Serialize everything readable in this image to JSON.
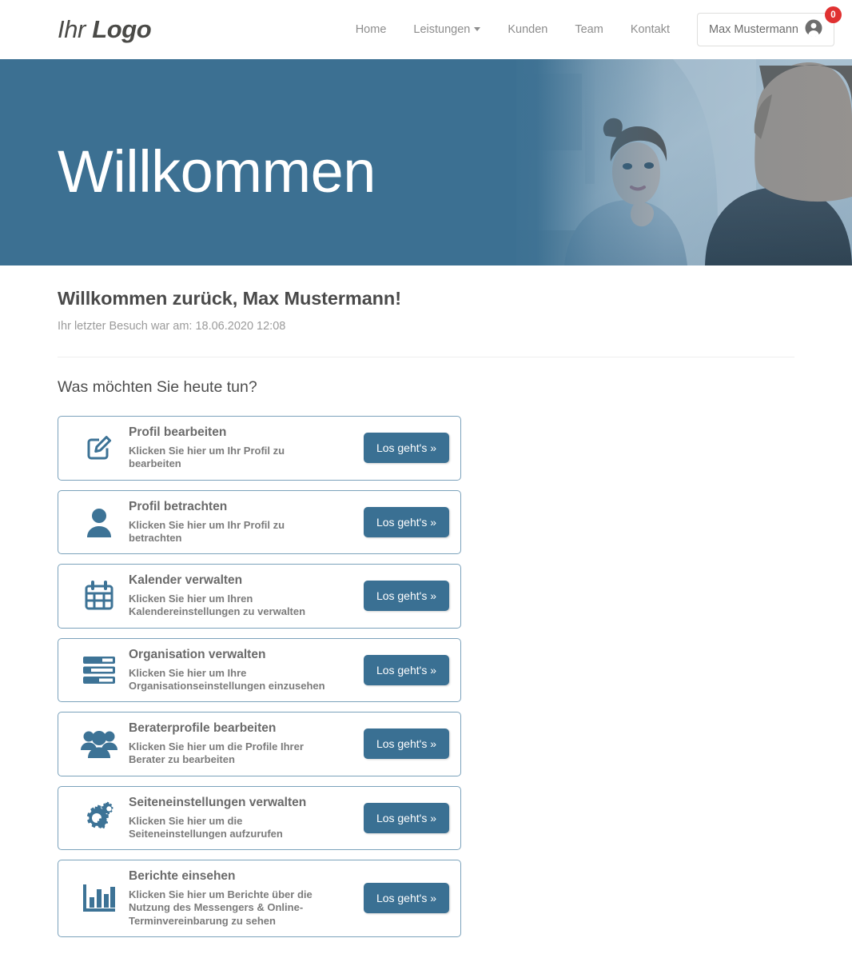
{
  "navbar": {
    "logo_light": "Ihr",
    "logo_bold": "Logo",
    "links": [
      {
        "label": "Home",
        "icon": "",
        "has_caret": false
      },
      {
        "label": "Leistungen",
        "icon": "chevron-down-icon",
        "has_caret": true
      },
      {
        "label": "Kunden",
        "icon": "",
        "has_caret": false
      },
      {
        "label": "Team",
        "icon": "",
        "has_caret": false
      },
      {
        "label": "Kontakt",
        "icon": "",
        "has_caret": false
      }
    ],
    "user": {
      "name": "Max Mustermann",
      "avatar_icon": "user-avatar-icon",
      "badge_count": "0",
      "badge_color": "#e03131"
    }
  },
  "hero": {
    "title": "Willkommen",
    "overlay_color": "#3c7092"
  },
  "main": {
    "welcome_title": "Willkommen zurück, Max Mustermann!",
    "last_visit": "Ihr letzter Besuch war am: 18.06.2020 12:08",
    "section_title": "Was möchten Sie heute tun?",
    "accent_color": "#3a7093",
    "card_border_color": "#7ba2bb",
    "cards": [
      {
        "icon": "edit-profile-icon",
        "title": "Profil bearbeiten",
        "description": "Klicken Sie hier um Ihr Profil zu bearbeiten",
        "button": "Los geht's »"
      },
      {
        "icon": "user-icon",
        "title": "Profil betrachten",
        "description": "Klicken Sie hier um Ihr Profil zu betrachten",
        "button": "Los geht's »"
      },
      {
        "icon": "calendar-icon",
        "title": "Kalender verwalten",
        "description": "Klicken Sie hier um Ihren Kalendereinstellungen zu verwalten",
        "button": "Los geht's »"
      },
      {
        "icon": "server-icon",
        "title": "Organisation verwalten",
        "description": "Klicken Sie hier um Ihre Organisationseinstellungen einzusehen",
        "button": "Los geht's »"
      },
      {
        "icon": "group-users-icon",
        "title": "Beraterprofile bearbeiten",
        "description": "Klicken Sie hier um die Profile Ihrer Berater zu bearbeiten",
        "button": "Los geht's »"
      },
      {
        "icon": "cogs-icon",
        "title": "Seiteneinstellungen verwalten",
        "description": "Klicken Sie hier um die Seiteneinstellungen aufzurufen",
        "button": "Los geht's »"
      },
      {
        "icon": "bar-chart-icon",
        "title": "Berichte einsehen",
        "description": "Klicken Sie hier um Berichte über die Nutzung des Messengers & Online-Terminvereinbarung zu sehen",
        "button": "Los geht's »"
      }
    ]
  }
}
